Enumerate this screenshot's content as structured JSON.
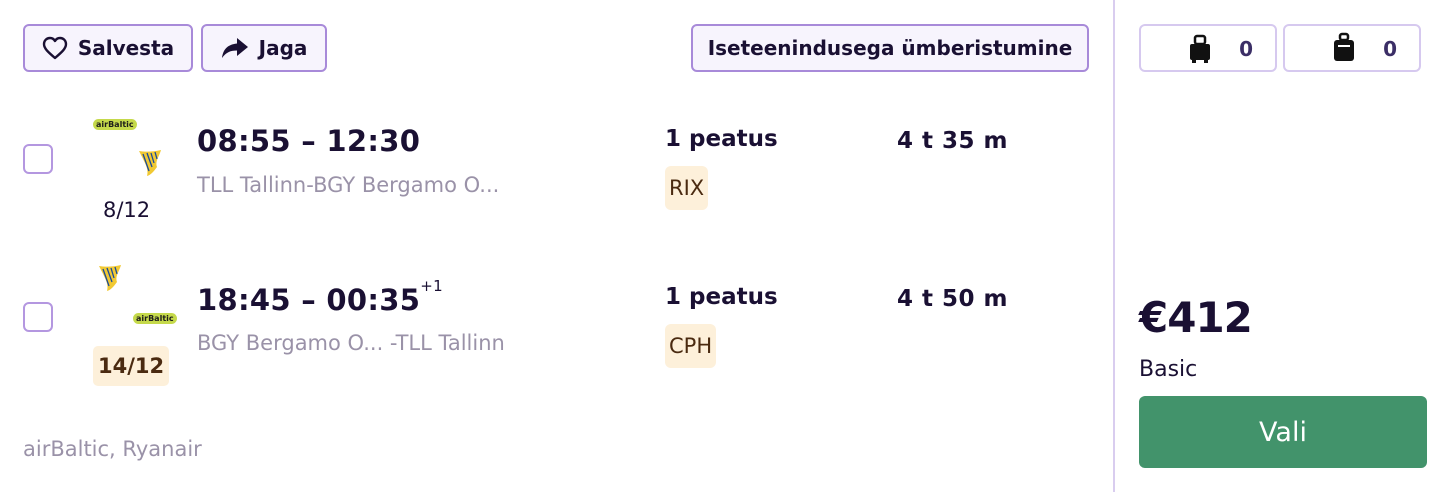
{
  "toolbar": {
    "save_label": "Salvesta",
    "share_label": "Jaga",
    "self_transfer_label": "Iseteenindusega ümberistumine"
  },
  "baggage": {
    "checked_count": "0",
    "cabin_count": "0"
  },
  "legs": [
    {
      "airline_badge": "airBaltic",
      "date": "8/12",
      "time": "08:55 – 12:30",
      "day_offset": "",
      "route": "TLL Tallinn-BGY Bergamo O...",
      "stops": "1 peatus",
      "stop_airport": "RIX",
      "duration": "4 t 35 m"
    },
    {
      "airline_badge": "airBaltic",
      "date": "14/12",
      "time": "18:45 – 00:35",
      "day_offset": "+1",
      "route": "BGY Bergamo O... -TLL Tallinn",
      "stops": "1 peatus",
      "stop_airport": "CPH",
      "duration": "4 t 50 m"
    }
  ],
  "carriers": "airBaltic, Ryanair",
  "price": {
    "amount": "€412",
    "fare_name": "Basic",
    "select_label": "Vali"
  },
  "colors": {
    "accent_border": "#a88ad9",
    "select_button": "#42936b",
    "stop_tag_bg": "#fdf0da",
    "airbaltic_green": "#c5d94b",
    "ryanair_yellow": "#f1c933"
  }
}
